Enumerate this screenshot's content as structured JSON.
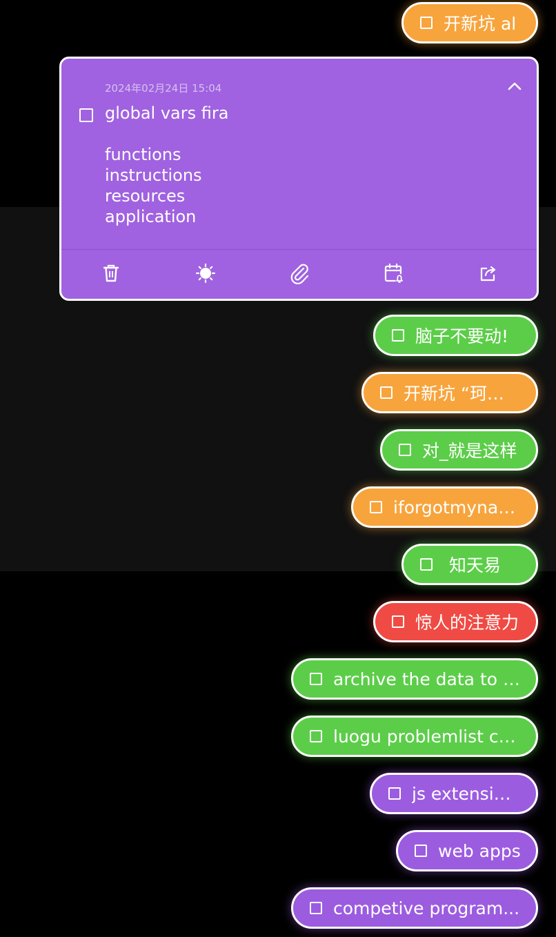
{
  "chips": [
    {
      "id": "chip-1",
      "text": "开新坑 al",
      "color": "orange",
      "done": false
    },
    {
      "id": "chip-2",
      "text": "脑子不要动!",
      "color": "green",
      "done": false
    },
    {
      "id": "chip-3",
      "text": "开新坑 “珂朵莉",
      "color": "orange",
      "done": false
    },
    {
      "id": "chip-4",
      "text": "对_就是这样",
      "color": "green",
      "done": false
    },
    {
      "id": "chip-5",
      "text": "iforgotmyname",
      "color": "orange",
      "done": false
    },
    {
      "id": "chip-6",
      "text": "知天易",
      "color": "green",
      "done": false
    },
    {
      "id": "chip-7",
      "text": "惊人的注意力",
      "color": "red",
      "done": false
    },
    {
      "id": "chip-8",
      "text": "archive the data to t...",
      "color": "green",
      "done": false
    },
    {
      "id": "chip-9",
      "text": "luogu problemlist cu...",
      "color": "green",
      "done": false
    },
    {
      "id": "chip-10",
      "text": "js extensions",
      "color": "purple",
      "done": false
    },
    {
      "id": "chip-11",
      "text": "web apps",
      "color": "purple",
      "done": false
    },
    {
      "id": "chip-12",
      "text": "competive program...",
      "color": "purple",
      "done": false
    }
  ],
  "expanded_note": {
    "date": "2024年02月24日 15:04",
    "body": "global vars fira\n\nfunctions\ninstructions\nresources\napplication",
    "done": false,
    "color": "#a062e0",
    "toolbar": [
      {
        "name": "trash-icon"
      },
      {
        "name": "color-palette-icon"
      },
      {
        "name": "attachment-icon"
      },
      {
        "name": "calendar-reminder-icon"
      },
      {
        "name": "share-icon"
      }
    ]
  },
  "colors": {
    "orange": "#f7a43d",
    "green": "#5ccd49",
    "red": "#ef4b44",
    "purple": "#9c5ce0"
  }
}
